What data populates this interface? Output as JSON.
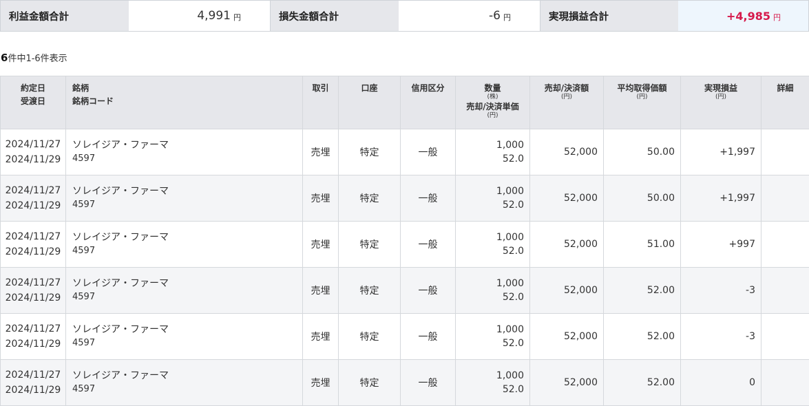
{
  "summary": {
    "profit_label": "利益金額合計",
    "profit_value": "4,991",
    "loss_label": "損失金額合計",
    "loss_value": "-6",
    "realized_label": "実現損益合計",
    "realized_value": "+4,985",
    "unit": "円"
  },
  "count": {
    "total": "6",
    "text": "件中1-6件表示"
  },
  "table": {
    "headers": {
      "date1": "約定日",
      "date2": "受渡日",
      "name1": "銘柄",
      "name2": "銘柄コード",
      "trade": "取引",
      "account": "口座",
      "credit": "信用区分",
      "qty": "数量",
      "qty_unit": "(株)",
      "price": "売却/決済単価",
      "price_unit": "(円)",
      "amount": "売却/決済額",
      "amount_unit": "(円)",
      "avg": "平均取得価額",
      "avg_unit": "(円)",
      "pl": "実現損益",
      "pl_unit": "(円)",
      "detail": "詳細"
    },
    "rows": [
      {
        "trade_date": "2024/11/27",
        "settle_date": "2024/11/29",
        "name": "ソレイジア・ファーマ",
        "code": "4597",
        "trade": "売埋",
        "account": "特定",
        "credit": "一般",
        "qty": "1,000",
        "price": "52.0",
        "amount": "52,000",
        "avg": "50.00",
        "pl": "+1,997",
        "pl_sign": "pos"
      },
      {
        "trade_date": "2024/11/27",
        "settle_date": "2024/11/29",
        "name": "ソレイジア・ファーマ",
        "code": "4597",
        "trade": "売埋",
        "account": "特定",
        "credit": "一般",
        "qty": "1,000",
        "price": "52.0",
        "amount": "52,000",
        "avg": "50.00",
        "pl": "+1,997",
        "pl_sign": "pos"
      },
      {
        "trade_date": "2024/11/27",
        "settle_date": "2024/11/29",
        "name": "ソレイジア・ファーマ",
        "code": "4597",
        "trade": "売埋",
        "account": "特定",
        "credit": "一般",
        "qty": "1,000",
        "price": "52.0",
        "amount": "52,000",
        "avg": "51.00",
        "pl": "+997",
        "pl_sign": "pos"
      },
      {
        "trade_date": "2024/11/27",
        "settle_date": "2024/11/29",
        "name": "ソレイジア・ファーマ",
        "code": "4597",
        "trade": "売埋",
        "account": "特定",
        "credit": "一般",
        "qty": "1,000",
        "price": "52.0",
        "amount": "52,000",
        "avg": "52.00",
        "pl": "-3",
        "pl_sign": "neg"
      },
      {
        "trade_date": "2024/11/27",
        "settle_date": "2024/11/29",
        "name": "ソレイジア・ファーマ",
        "code": "4597",
        "trade": "売埋",
        "account": "特定",
        "credit": "一般",
        "qty": "1,000",
        "price": "52.0",
        "amount": "52,000",
        "avg": "52.00",
        "pl": "-3",
        "pl_sign": "neg"
      },
      {
        "trade_date": "2024/11/27",
        "settle_date": "2024/11/29",
        "name": "ソレイジア・ファーマ",
        "code": "4597",
        "trade": "売埋",
        "account": "特定",
        "credit": "一般",
        "qty": "1,000",
        "price": "52.0",
        "amount": "52,000",
        "avg": "52.00",
        "pl": "0",
        "pl_sign": "zero"
      }
    ]
  },
  "colors": {
    "positive": "#d6194b",
    "negative": "#2e8b1e",
    "header_bg": "#e6e7eb"
  }
}
